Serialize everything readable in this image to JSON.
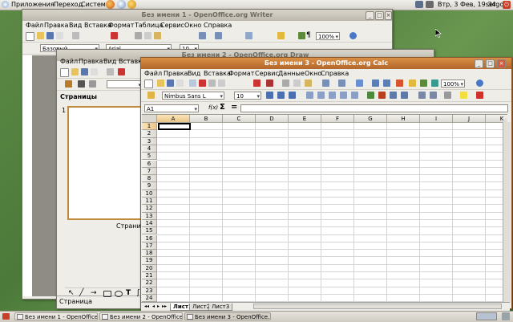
{
  "top_panel": {
    "menus": [
      "Приложения",
      "Переход",
      "Система"
    ],
    "clock": "Втр,  3 Фев, 19:34",
    "user": "sergo"
  },
  "writer": {
    "title": "Без имени 1 - OpenOffice.org Writer",
    "menu": [
      "Файл",
      "Правка",
      "Вид",
      "Вставка",
      "Формат",
      "Таблица",
      "Сервис",
      "Окно",
      "Справка"
    ],
    "style_value": "Базовый",
    "font_value": "Arial",
    "size_value": "10",
    "zoom_value": "100%"
  },
  "draw": {
    "title": "Без имени 2 - OpenOffice.org Draw",
    "menu": [
      "Файл",
      "Правка",
      "Вид",
      "Вставка"
    ],
    "panel_title": "Страницы",
    "page_number": "1",
    "slide_label": "Страница 1",
    "status_text": "Страница"
  },
  "calc": {
    "title": "Без имени 3 - OpenOffice.org Calc",
    "menu": [
      "Файл",
      "Правка",
      "Вид",
      "Вставка",
      "Формат",
      "Сервис",
      "Данные",
      "Окно",
      "Справка"
    ],
    "zoom_value": "100%",
    "font_value": "Nimbus Sans L",
    "size_value": "10",
    "name_box": "A1",
    "fx_label": "f(x)",
    "sum_label": "Σ",
    "equals_label": "=",
    "columns": [
      "A",
      "B",
      "C",
      "D",
      "E",
      "F",
      "G",
      "H",
      "I",
      "J",
      "K"
    ],
    "rows": [
      "1",
      "2",
      "3",
      "4",
      "5",
      "6",
      "7",
      "8",
      "9",
      "10",
      "11",
      "12",
      "13",
      "14",
      "15",
      "16",
      "17",
      "18",
      "19",
      "20",
      "21",
      "22",
      "23",
      "24"
    ],
    "sheet_tabs": [
      "Лист1",
      "Лист2",
      "Лист3"
    ]
  },
  "taskbar": {
    "tasks": [
      "Без имени 1 - OpenOffice...",
      "Без имени 2 - OpenOffice...",
      "Без имени 3 - OpenOffice..."
    ]
  },
  "colors": {
    "active_title": "#c47a38",
    "desktop": "#5d8a45"
  }
}
